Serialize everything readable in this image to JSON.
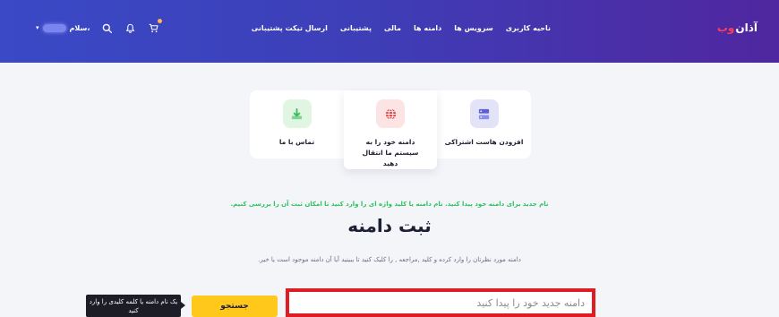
{
  "header": {
    "logo_text": "آذان",
    "logo_accent": "وب",
    "nav": [
      "ناحیه کاربری",
      "سرویس ها",
      "دامنه ها",
      "مالی",
      "پشتیبانی",
      "ارسال تیکت پشتیبانی"
    ],
    "greeting": "سلام،",
    "icons": [
      "cart-icon",
      "bell-icon",
      "search-icon",
      "chevron-down-icon"
    ]
  },
  "cards": [
    {
      "label": "افزودن هاست اشتراکی",
      "icon": "server-icon",
      "color": "#5b5fd8"
    },
    {
      "label": "دامنه خود را به سیستم ما انتقال دهید",
      "icon": "globe-icon",
      "color": "#e54848"
    },
    {
      "label": "تماس با ما",
      "icon": "download-icon",
      "color": "#3dbb5c"
    }
  ],
  "main": {
    "subtitle": "نام جدید برای دامنه خود پیدا کنید. نام دامنه یا کلید واژه ای را وارد کنید تا امکان ثبت آن را بررسی کنیم.",
    "title": "ثبت دامنه",
    "description": "دامنه مورد نظرتان را وارد کرده و کلید ,مراجعه , را کلیک کنید تا ببینید آیا آن دامنه موجود است یا خیر.",
    "search_placeholder": "دامنه جدید خود را پیدا کنید",
    "search_button": "جستجو",
    "tooltip": "یک نام دامنه یا کلمه کلیدی را وارد کنید"
  },
  "colors": {
    "header_start": "#3a49c6",
    "header_end": "#4f27a0",
    "accent_green": "#2fc260",
    "button_yellow": "#ffc81a",
    "highlight_red": "#e01b24"
  }
}
